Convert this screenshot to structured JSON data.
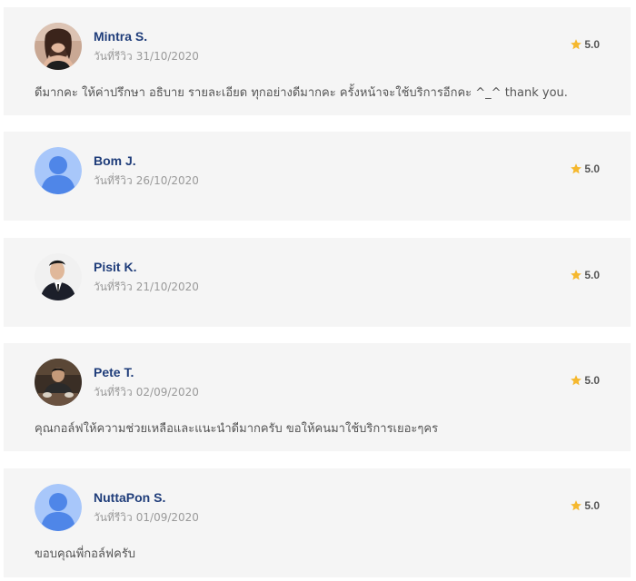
{
  "reviews": [
    {
      "name": "Mintra S.",
      "date_label": "วันที่รีวิว",
      "date": "31/10/2020",
      "rating": "5.0",
      "text": "ดีมากคะ ให้ค่าปรึกษา อธิบาย รายละเอียด ทุกอย่างดีมากคะ ครั้งหน้าจะใช้บริการอีกคะ ^_^ thank you.",
      "avatar": "photo-woman"
    },
    {
      "name": "Bom J.",
      "date_label": "วันที่รีวิว",
      "date": "26/10/2020",
      "rating": "5.0",
      "text": "",
      "avatar": "default-user"
    },
    {
      "name": "Pisit K.",
      "date_label": "วันที่รีวิว",
      "date": "21/10/2020",
      "rating": "5.0",
      "text": "",
      "avatar": "photo-man-suit"
    },
    {
      "name": "Pete T.",
      "date_label": "วันที่รีวิว",
      "date": "02/09/2020",
      "rating": "5.0",
      "text": "คุณกอล์ฟให้ความช่วยเหลือและแนะนำดีมากครับ ขอให้คนมาใช้บริการเยอะๆคร",
      "avatar": "photo-man-cafe"
    },
    {
      "name": "NuttaPon S.",
      "date_label": "วันที่รีวิว",
      "date": "01/09/2020",
      "rating": "5.0",
      "text": "ขอบคุณพี่กอล์ฟครับ",
      "avatar": "default-user"
    }
  ],
  "colors": {
    "card_bg": "#f5f5f5",
    "name": "#1f3d7a",
    "date": "#9a9a9a",
    "text": "#555555",
    "star": "#f5b82e",
    "default_avatar_bg": "#a8c7fa",
    "default_avatar_fg": "#4f86e8"
  },
  "icons": {
    "rating": "star-icon"
  }
}
